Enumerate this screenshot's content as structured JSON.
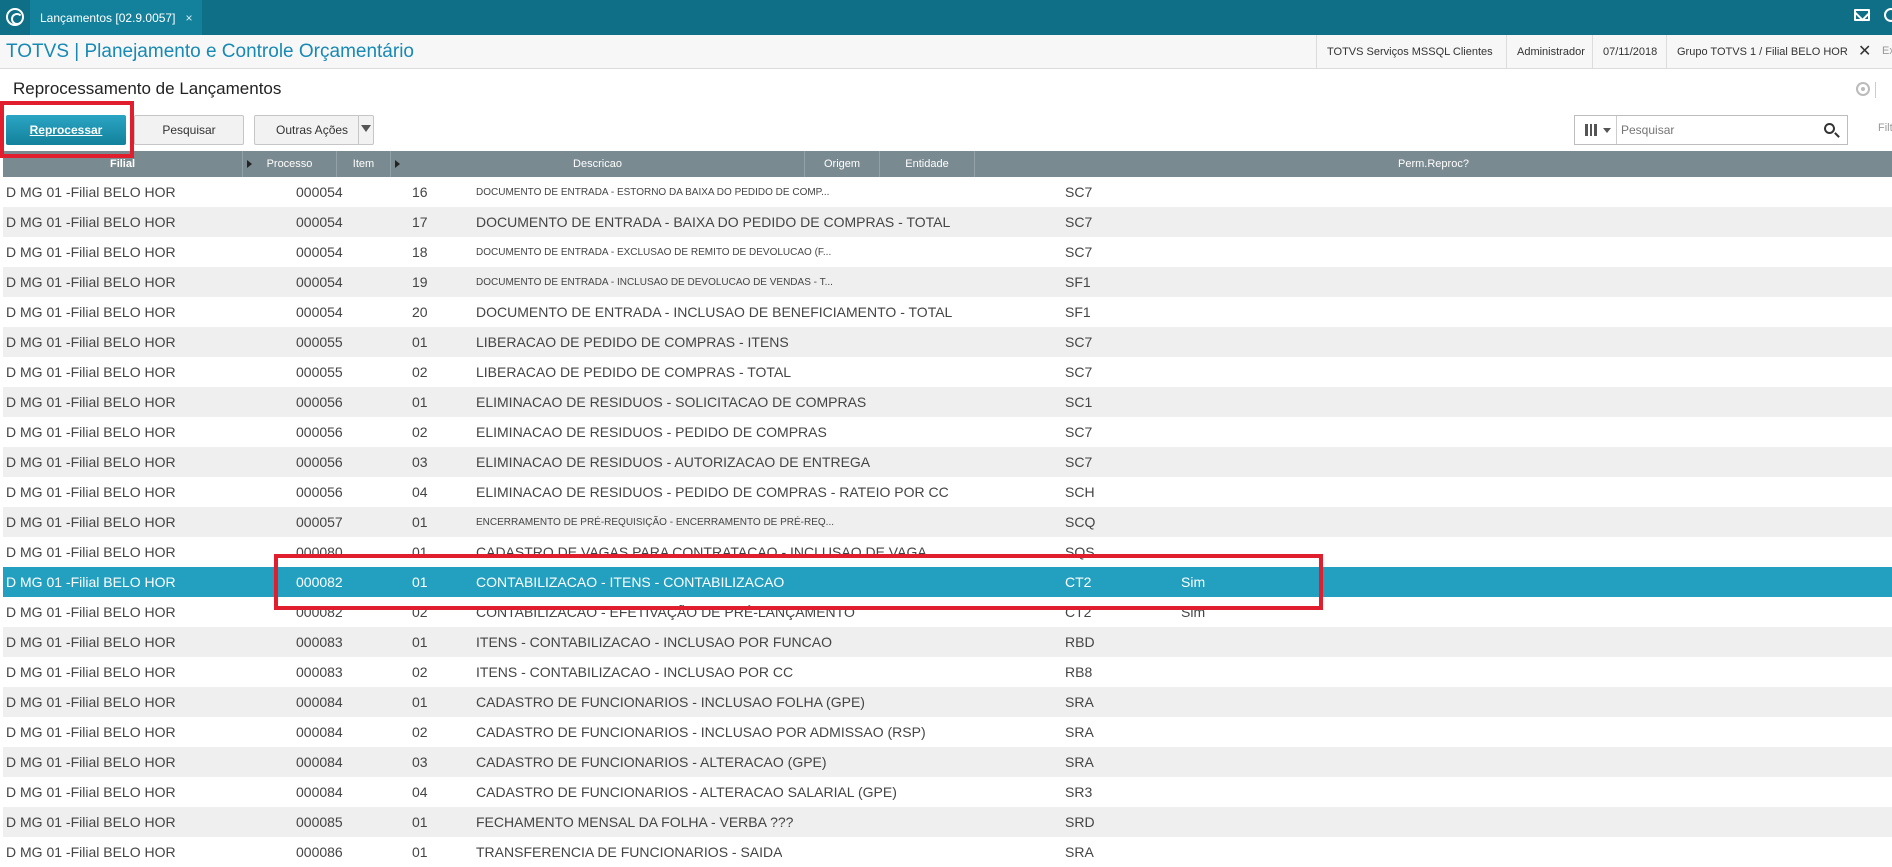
{
  "tab": {
    "title": "Lançamentos [02.9.0057]",
    "close": "×"
  },
  "app": {
    "title": "TOTVS | Planejamento e Controle Orçamentário",
    "environment": "TOTVS Serviços MSSQL Clientes",
    "user": "Administrador",
    "date": "07/11/2018",
    "company": "Grupo TOTVS 1 / Filial BELO HOR",
    "close": "✕",
    "exit": "Ex"
  },
  "page": {
    "title": "Reprocessamento de Lançamentos"
  },
  "toolbar": {
    "reprocess_label": "Reprocessar",
    "search_label": "Pesquisar",
    "more_label": "Outras Ações"
  },
  "search": {
    "placeholder": "Pesquisar",
    "filter_label": "Filt"
  },
  "table": {
    "headers": {
      "filial": "Filial",
      "processo": "Processo",
      "item": "Item",
      "descricao": "Descricao",
      "origem": "Origem",
      "entidade": "Entidade",
      "perm": "Perm.Reproc?"
    },
    "rows": [
      {
        "filial": "D MG 01 -Filial BELO HOR",
        "processo": "000054",
        "item": "16",
        "descricao": "DOCUMENTO DE ENTRADA - ESTORNO DA BAIXA DO PEDIDO DE COMP...",
        "small": true,
        "origem": "",
        "entidade": "SC7",
        "perm": ""
      },
      {
        "filial": "D MG 01 -Filial BELO HOR",
        "processo": "000054",
        "item": "17",
        "descricao": "DOCUMENTO DE ENTRADA - BAIXA DO PEDIDO DE COMPRAS - TOTAL",
        "small": false,
        "origem": "",
        "entidade": "SC7",
        "perm": ""
      },
      {
        "filial": "D MG 01 -Filial BELO HOR",
        "processo": "000054",
        "item": "18",
        "descricao": "DOCUMENTO DE ENTRADA - EXCLUSAO DE REMITO DE DEVOLUCAO (F...",
        "small": true,
        "origem": "",
        "entidade": "SC7",
        "perm": ""
      },
      {
        "filial": "D MG 01 -Filial BELO HOR",
        "processo": "000054",
        "item": "19",
        "descricao": "DOCUMENTO DE ENTRADA - INCLUSAO DE DEVOLUCAO DE VENDAS - T...",
        "small": true,
        "origem": "",
        "entidade": "SF1",
        "perm": ""
      },
      {
        "filial": "D MG 01 -Filial BELO HOR",
        "processo": "000054",
        "item": "20",
        "descricao": "DOCUMENTO DE ENTRADA - INCLUSAO DE BENEFICIAMENTO - TOTAL",
        "small": false,
        "origem": "",
        "entidade": "SF1",
        "perm": ""
      },
      {
        "filial": "D MG 01 -Filial BELO HOR",
        "processo": "000055",
        "item": "01",
        "descricao": "LIBERACAO DE PEDIDO DE COMPRAS - ITENS",
        "small": false,
        "origem": "",
        "entidade": "SC7",
        "perm": ""
      },
      {
        "filial": "D MG 01 -Filial BELO HOR",
        "processo": "000055",
        "item": "02",
        "descricao": "LIBERACAO DE PEDIDO DE COMPRAS - TOTAL",
        "small": false,
        "origem": "",
        "entidade": "SC7",
        "perm": ""
      },
      {
        "filial": "D MG 01 -Filial BELO HOR",
        "processo": "000056",
        "item": "01",
        "descricao": "ELIMINACAO DE RESIDUOS - SOLICITACAO DE COMPRAS",
        "small": false,
        "origem": "",
        "entidade": "SC1",
        "perm": ""
      },
      {
        "filial": "D MG 01 -Filial BELO HOR",
        "processo": "000056",
        "item": "02",
        "descricao": "ELIMINACAO DE RESIDUOS - PEDIDO DE COMPRAS",
        "small": false,
        "origem": "",
        "entidade": "SC7",
        "perm": ""
      },
      {
        "filial": "D MG 01 -Filial BELO HOR",
        "processo": "000056",
        "item": "03",
        "descricao": "ELIMINACAO DE RESIDUOS - AUTORIZACAO DE ENTREGA",
        "small": false,
        "origem": "",
        "entidade": "SC7",
        "perm": ""
      },
      {
        "filial": "D MG 01 -Filial BELO HOR",
        "processo": "000056",
        "item": "04",
        "descricao": "ELIMINACAO DE RESIDUOS - PEDIDO DE COMPRAS - RATEIO POR CC",
        "small": false,
        "origem": "",
        "entidade": "SCH",
        "perm": ""
      },
      {
        "filial": "D MG 01 -Filial BELO HOR",
        "processo": "000057",
        "item": "01",
        "descricao": "ENCERRAMENTO DE PRÉ-REQUISIÇÃO - ENCERRAMENTO DE PRÉ-REQ...",
        "small": true,
        "origem": "",
        "entidade": "SCQ",
        "perm": ""
      },
      {
        "filial": "D MG 01 -Filial BELO HOR",
        "processo": "000080",
        "item": "01",
        "descricao": "CADASTRO DE VAGAS PARA CONTRATACAO - INCLUSAO DE VAGA",
        "small": false,
        "origem": "",
        "entidade": "SQS",
        "perm": ""
      },
      {
        "filial": "D MG 01 -Filial BELO HOR",
        "processo": "000082",
        "item": "01",
        "descricao": "CONTABILIZACAO - ITENS - CONTABILIZACAO",
        "small": false,
        "origem": "",
        "entidade": "CT2",
        "perm": "Sim",
        "selected": true
      },
      {
        "filial": "D MG 01 -Filial BELO HOR",
        "processo": "000082",
        "item": "02",
        "descricao": "CONTABILIZACAO - EFETIVAÇÃO DE PRÉ-LANÇAMENTO",
        "small": false,
        "origem": "",
        "entidade": "CT2",
        "perm": "Sim"
      },
      {
        "filial": "D MG 01 -Filial BELO HOR",
        "processo": "000083",
        "item": "01",
        "descricao": "ITENS - CONTABILIZACAO - INCLUSAO POR FUNCAO",
        "small": false,
        "origem": "",
        "entidade": "RBD",
        "perm": ""
      },
      {
        "filial": "D MG 01 -Filial BELO HOR",
        "processo": "000083",
        "item": "02",
        "descricao": "ITENS - CONTABILIZACAO - INCLUSAO POR CC",
        "small": false,
        "origem": "",
        "entidade": "RB8",
        "perm": ""
      },
      {
        "filial": "D MG 01 -Filial BELO HOR",
        "processo": "000084",
        "item": "01",
        "descricao": "CADASTRO DE FUNCIONARIOS - INCLUSAO FOLHA (GPE)",
        "small": false,
        "origem": "",
        "entidade": "SRA",
        "perm": ""
      },
      {
        "filial": "D MG 01 -Filial BELO HOR",
        "processo": "000084",
        "item": "02",
        "descricao": "CADASTRO DE FUNCIONARIOS - INCLUSAO POR ADMISSAO (RSP)",
        "small": false,
        "origem": "",
        "entidade": "SRA",
        "perm": ""
      },
      {
        "filial": "D MG 01 -Filial BELO HOR",
        "processo": "000084",
        "item": "03",
        "descricao": "CADASTRO DE FUNCIONARIOS - ALTERACAO (GPE)",
        "small": false,
        "origem": "",
        "entidade": "SRA",
        "perm": ""
      },
      {
        "filial": "D MG 01 -Filial BELO HOR",
        "processo": "000084",
        "item": "04",
        "descricao": "CADASTRO DE FUNCIONARIOS - ALTERACAO SALARIAL (GPE)",
        "small": false,
        "origem": "",
        "entidade": "SR3",
        "perm": ""
      },
      {
        "filial": "D MG 01 -Filial BELO HOR",
        "processo": "000085",
        "item": "01",
        "descricao": "FECHAMENTO MENSAL DA FOLHA - VERBA ???",
        "small": false,
        "origem": "",
        "entidade": "SRD",
        "perm": ""
      },
      {
        "filial": "D MG 01 -Filial BELO HOR",
        "processo": "000086",
        "item": "01",
        "descricao": "TRANSFERENCIA DE FUNCIONARIOS - SAIDA",
        "small": false,
        "origem": "",
        "entidade": "SRA",
        "perm": ""
      }
    ]
  },
  "colors": {
    "topbar": "#0e6f86",
    "accent": "#1889b4",
    "selected_row": "#23a0c0",
    "highlight": "#e01e2d",
    "header": "#7a8a91"
  }
}
